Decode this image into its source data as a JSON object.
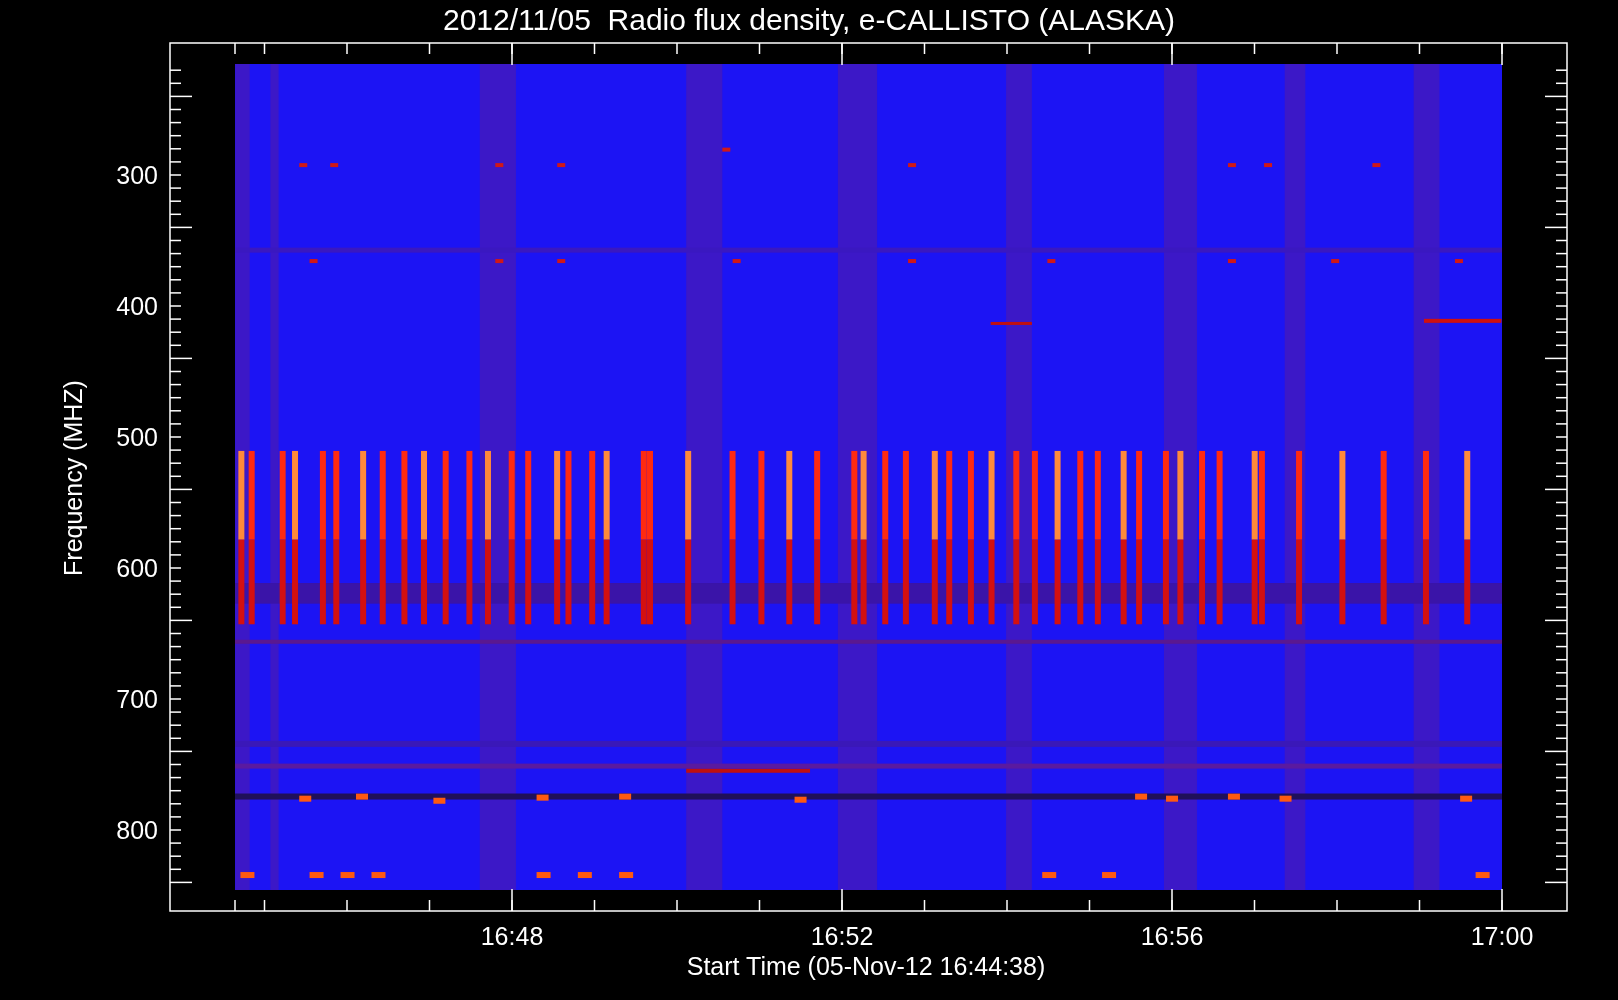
{
  "plot": {
    "title": "2012/11/05  Radio flux density, e-CALLISTO (ALASKA)",
    "ylabel": "Frequency (MHZ)",
    "xlabel": "Start Time (05-Nov-12 16:44:38)",
    "yticks": [
      "300",
      "400",
      "500",
      "600",
      "700",
      "800"
    ],
    "xticks": [
      "16:48",
      "16:52",
      "16:56",
      "17:00"
    ]
  }
}
